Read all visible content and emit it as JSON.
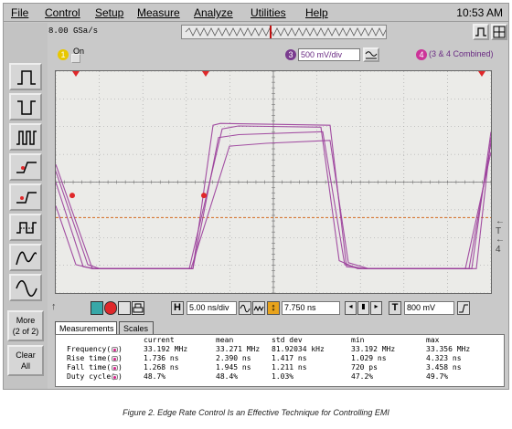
{
  "menu": {
    "items": [
      "File",
      "Control",
      "Setup",
      "Measure",
      "Analyze",
      "Utilities",
      "Help"
    ],
    "clock": "10:53 AM"
  },
  "acquisition": {
    "sample_rate": "8.00 GSa/s"
  },
  "channels": [
    {
      "number": "1",
      "state": "On",
      "color": "#e8c700"
    },
    {
      "number": "3",
      "scale": "500 mV/div",
      "color": "#7a3c8f"
    },
    {
      "number": "4",
      "label": "(3 & 4 Combined)",
      "color": "#cc3399"
    }
  ],
  "timebase": {
    "h_label": "H",
    "scale": "5.00 ns/div",
    "delay": "7.750 ns",
    "t_label": "T",
    "trigger_level": "800 mV"
  },
  "left_toolbar": {
    "more_label": "More\n(2 of 2)",
    "clear_label": "Clear\nAll"
  },
  "tabs": [
    "Measurements",
    "Scales"
  ],
  "measurements": {
    "headers": [
      "current",
      "mean",
      "std dev",
      "min",
      "max"
    ],
    "rows": [
      {
        "name": "Frequency(",
        "values": [
          "33.192 MHz",
          "33.271 MHz",
          "81.92034 kHz",
          "33.192 MHz",
          "33.356 MHz"
        ]
      },
      {
        "name": "Rise time(",
        "values": [
          "1.736 ns",
          "2.390 ns",
          "1.417 ns",
          "1.029 ns",
          "4.323 ns"
        ]
      },
      {
        "name": "Fall time(",
        "values": [
          "1.268 ns",
          "1.945 ns",
          "1.211 ns",
          "720 ps",
          "3.458 ns"
        ]
      },
      {
        "name": "Duty cycle(",
        "values": [
          "48.7%",
          "48.4%",
          "1.03%",
          "47.2%",
          "49.7%"
        ]
      }
    ]
  },
  "caption": "Figure 2. Edge Rate Control Is an Effective Technique for Controlling EMI",
  "colors": {
    "trace": "#9a3d9a",
    "marker": "#e0282a",
    "threshold": "#d46a1e",
    "screen_bg": "#ebebe8"
  }
}
